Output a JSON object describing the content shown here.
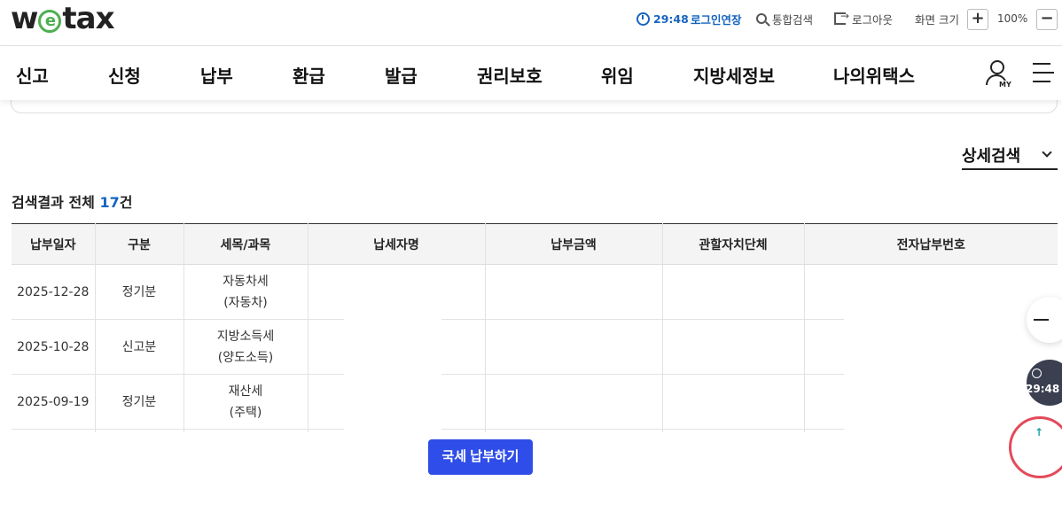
{
  "header": {
    "logo_pre": "w",
    "logo_e": "e",
    "logo_post": "tax",
    "timer": "29:48",
    "extend_login": "로그인연장",
    "unified_search": "통합검색",
    "logout": "로그아웃",
    "zoom_label": "화면 크기",
    "zoom_plus": "+",
    "zoom_value": "100%",
    "zoom_minus": "−"
  },
  "nav": {
    "items": [
      "신고",
      "신청",
      "납부",
      "환급",
      "발급",
      "권리보호",
      "위임",
      "지방세정보",
      "나의위택스"
    ],
    "my_label": "MY"
  },
  "search": {
    "detail_search": "상세검색"
  },
  "results": {
    "title_prefix": "검색결과 전체 ",
    "count": "17",
    "title_suffix": "건"
  },
  "table": {
    "columns": [
      "납부일자",
      "구분",
      "세목/과목",
      "납세자명",
      "납부금액",
      "관할자치단체",
      "전자납부번호"
    ],
    "rows": [
      {
        "date": "2025-12-28",
        "type": "정기분",
        "tax_line1": "자동차세",
        "tax_line2": "(자동차)"
      },
      {
        "date": "2025-10-28",
        "type": "신고분",
        "tax_line1": "지방소득세",
        "tax_line2": "(양도소득)"
      },
      {
        "date": "2025-09-19",
        "type": "정기분",
        "tax_line1": "재산세",
        "tax_line2": "(주택)"
      }
    ]
  },
  "actions": {
    "pay_national_tax": "국세 납부하기"
  },
  "floating": {
    "timer": "29:48",
    "top_arrow": "↑"
  }
}
